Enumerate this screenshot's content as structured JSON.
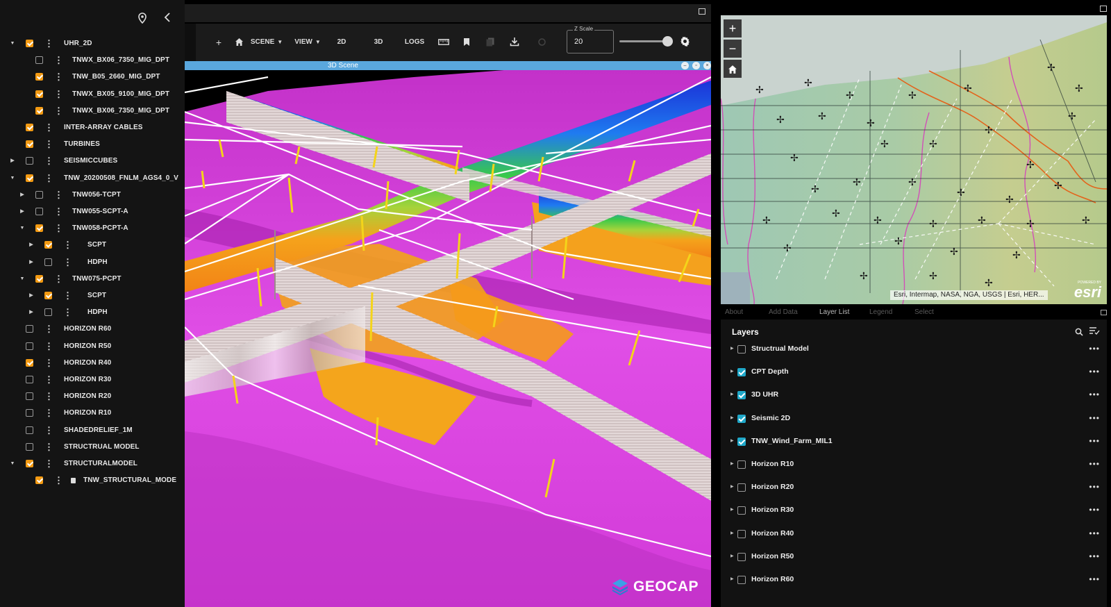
{
  "tree": {
    "items": [
      {
        "label": "UHR_2D",
        "checked": true,
        "caret": "down"
      },
      {
        "label": "TNWX_BX06_7350_MIG_DPT",
        "checked": false,
        "caret": ""
      },
      {
        "label": "TNW_B05_2660_MIG_DPT",
        "checked": true,
        "caret": ""
      },
      {
        "label": "TNWX_BX05_9100_MIG_DPT",
        "checked": true,
        "caret": ""
      },
      {
        "label": "TNWX_BX06_7350_MIG_DPT",
        "checked": true,
        "caret": ""
      },
      {
        "label": "INTER-ARRAY CABLES",
        "checked": true,
        "caret": ""
      },
      {
        "label": "TURBINES",
        "checked": true,
        "caret": ""
      },
      {
        "label": "SEISMICCUBES",
        "checked": false,
        "caret": "right"
      },
      {
        "label": "TNW_20200508_FNLM_AGS4_0_V",
        "checked": true,
        "caret": "down"
      },
      {
        "label": "TNW056-TCPT",
        "checked": false,
        "caret": "right"
      },
      {
        "label": "TNW055-SCPT-A",
        "checked": false,
        "caret": "right"
      },
      {
        "label": "TNW058-PCPT-A",
        "checked": true,
        "caret": "down"
      },
      {
        "label": "SCPT",
        "checked": true,
        "caret": "right"
      },
      {
        "label": "HDPH",
        "checked": false,
        "caret": "right"
      },
      {
        "label": "TNW075-PCPT",
        "checked": true,
        "caret": "down"
      },
      {
        "label": "SCPT",
        "checked": true,
        "caret": "right"
      },
      {
        "label": "HDPH",
        "checked": false,
        "caret": "right"
      },
      {
        "label": "HORIZON R60",
        "checked": false,
        "caret": ""
      },
      {
        "label": "HORIZON R50",
        "checked": false,
        "caret": ""
      },
      {
        "label": "HORIZON R40",
        "checked": true,
        "caret": ""
      },
      {
        "label": "HORIZON R30",
        "checked": false,
        "caret": ""
      },
      {
        "label": "HORIZON R20",
        "checked": false,
        "caret": ""
      },
      {
        "label": "HORIZON R10",
        "checked": false,
        "caret": ""
      },
      {
        "label": "SHADEDRELIEF_1M",
        "checked": false,
        "caret": ""
      },
      {
        "label": "STRUCTRUAL MODEL",
        "checked": false,
        "caret": ""
      },
      {
        "label": "STRUCTURALMODEL",
        "checked": true,
        "caret": "down"
      },
      {
        "label": "TNW_STRUCTURAL_MODE",
        "checked": true,
        "caret": ""
      }
    ]
  },
  "toolbar": {
    "add": "+",
    "scene": "SCENE",
    "view": "VIEW",
    "b2d": "2D",
    "b3d": "3D",
    "logs": "LOGS",
    "zscale_label": "Z Scale",
    "zscale_value": "20",
    "zscale_slider_fraction": 0.92
  },
  "scene": {
    "title": "3D Scene",
    "logo_text": "GEOCAP"
  },
  "map": {
    "zoom_in": "+",
    "zoom_out": "−",
    "attribution": "Esri, Intermap, NASA, NGA, USGS | Esri, HER...",
    "logo": "esri",
    "powered": "POWERED BY"
  },
  "tabs": [
    "About",
    "Add Data",
    "Layer List",
    "Legend",
    "Select"
  ],
  "active_tab": "Layer List",
  "layers": {
    "title": "Layers",
    "items": [
      {
        "label": "Structrual Model",
        "checked": false
      },
      {
        "label": "CPT Depth",
        "checked": true
      },
      {
        "label": "3D UHR",
        "checked": true
      },
      {
        "label": "Seismic 2D",
        "checked": true
      },
      {
        "label": "TNW_Wind_Farm_MIL1",
        "checked": true
      },
      {
        "label": "Horizon R10",
        "checked": false
      },
      {
        "label": "Horizon R20",
        "checked": false
      },
      {
        "label": "Horizon R30",
        "checked": false
      },
      {
        "label": "Horizon R40",
        "checked": false
      },
      {
        "label": "Horizon R50",
        "checked": false
      },
      {
        "label": "Horizon R60",
        "checked": false
      }
    ],
    "menu_glyph": "•••"
  },
  "colors": {
    "orange_check": "#f39a12",
    "blue_check": "#1fa8c9",
    "scene_title_bar": "#5aa7dd",
    "horizon_magenta": "#d03ad8"
  }
}
